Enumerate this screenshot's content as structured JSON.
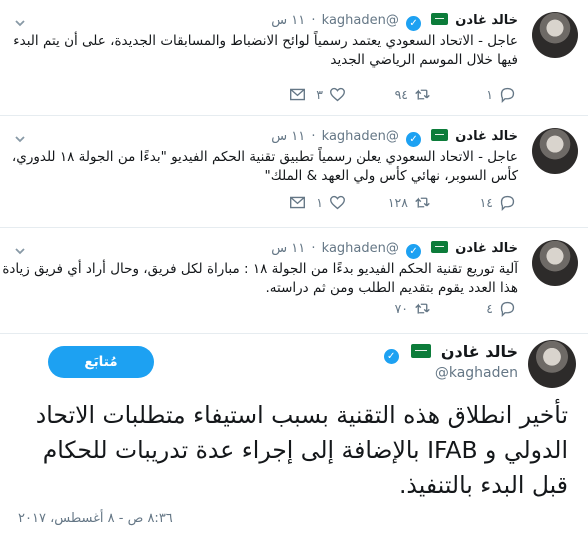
{
  "user": {
    "name": "خالد غادن",
    "handle": "@kaghaden"
  },
  "tweets": [
    {
      "time": "١١ س",
      "text": "عاجل - الاتحاد السعودي يعتمد رسمياً لوائح الانضباط والمسابقات الجديدة، على أن يتم البدء فيها خلال الموسم الرياضي الجديد",
      "replies": "١",
      "retweets": "٩٤",
      "likes": "٣"
    },
    {
      "time": "١١ س",
      "text": "عاجل - الاتحاد السعودي يعلن رسمياً تطبيق تقنية الحكم الفيديو \"بدءًا من الجولة ١٨ للدوري، كأس السوبر، نهائي كأس ولي العهد & الملك\"",
      "replies": "١٤",
      "retweets": "١٢٨",
      "likes": "١"
    },
    {
      "time": "١١ س",
      "text": "آلية توريع تقنية الحكم الفيديو بدءًا من الجولة ١٨ : مباراة لكل فريق، وحال أراد أي فريق زيادة هذا العدد يقوم بتقديم الطلب ومن ثم دراسته.",
      "replies": "٤",
      "retweets": "٧٠",
      "likes": ""
    }
  ],
  "main_tweet": {
    "follow_label": "مُتابَع",
    "text": "تأخير انطلاق هذه التقنية بسبب استيفاء متطلبات الاتحاد الدولي و IFAB بالإضافة إلى إجراء عدة تدريبات للحكام قبل البدء بالتنفيذ.",
    "timestamp": "٨:٣٦ ص - ٨ أغسطس، ٢٠١٧"
  },
  "colors": {
    "accent": "#1da1f2",
    "text": "#14171a",
    "muted": "#657786",
    "border": "#e6ecf0",
    "flag": "#0c7c3a"
  },
  "icons": [
    "reply-icon",
    "retweet-icon",
    "like-icon",
    "dm-icon",
    "chevron-down-icon",
    "verified-icon",
    "flag-icon"
  ]
}
